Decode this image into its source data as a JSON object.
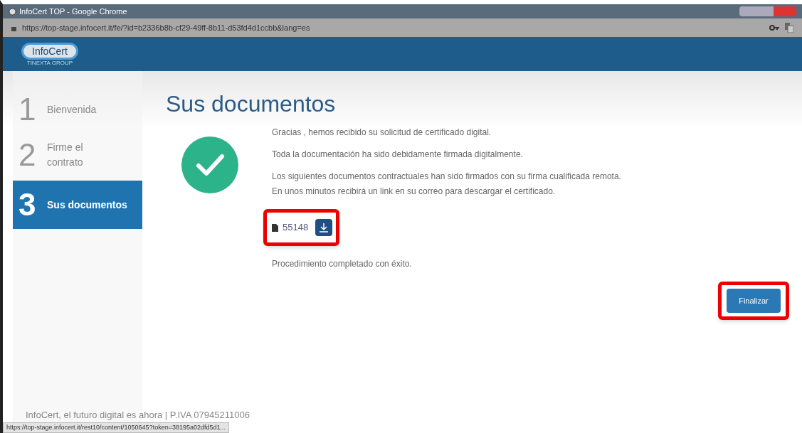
{
  "window": {
    "title": "InfoCert TOP - Google Chrome"
  },
  "address_bar": {
    "url": "https://top-stage.infocert.it/fe/?id=b2336b8b-cf29-49ff-8b11-d53fd4d1ccbb&lang=es"
  },
  "header": {
    "logo": "InfoCert",
    "logo_subtitle": "TINEXTA GROUP"
  },
  "steps": [
    {
      "number": "1",
      "label": "Bienvenida",
      "selected": false
    },
    {
      "number": "2",
      "label": "Firme el contrato",
      "selected": false
    },
    {
      "number": "3",
      "label": "Sus documentos",
      "selected": true
    }
  ],
  "main": {
    "title": "Sus documentos",
    "messages": [
      "Gracias , hemos recibido su solicitud de certificado digital.",
      "Toda la documentación ha sido debidamente firmada digitalmente.",
      "Los siguientes documentos contractuales han sido firmados con su firma cualificada remota.\nEn unos minutos recibirá un link en su correo para descargar el certificado."
    ],
    "document": {
      "name": "55148",
      "highlighted": true
    },
    "result": "Procedimiento completado con éxito.",
    "finish_button": {
      "label": "Finalizar",
      "highlighted": true
    }
  },
  "footer": "InfoCert, el futuro digital es ahora | P.IVA 07945211006",
  "status_bar": {
    "url": "https://top-stage.infocert.it/rest10/content/1050645?token=38195a02dfd5d1..."
  }
}
